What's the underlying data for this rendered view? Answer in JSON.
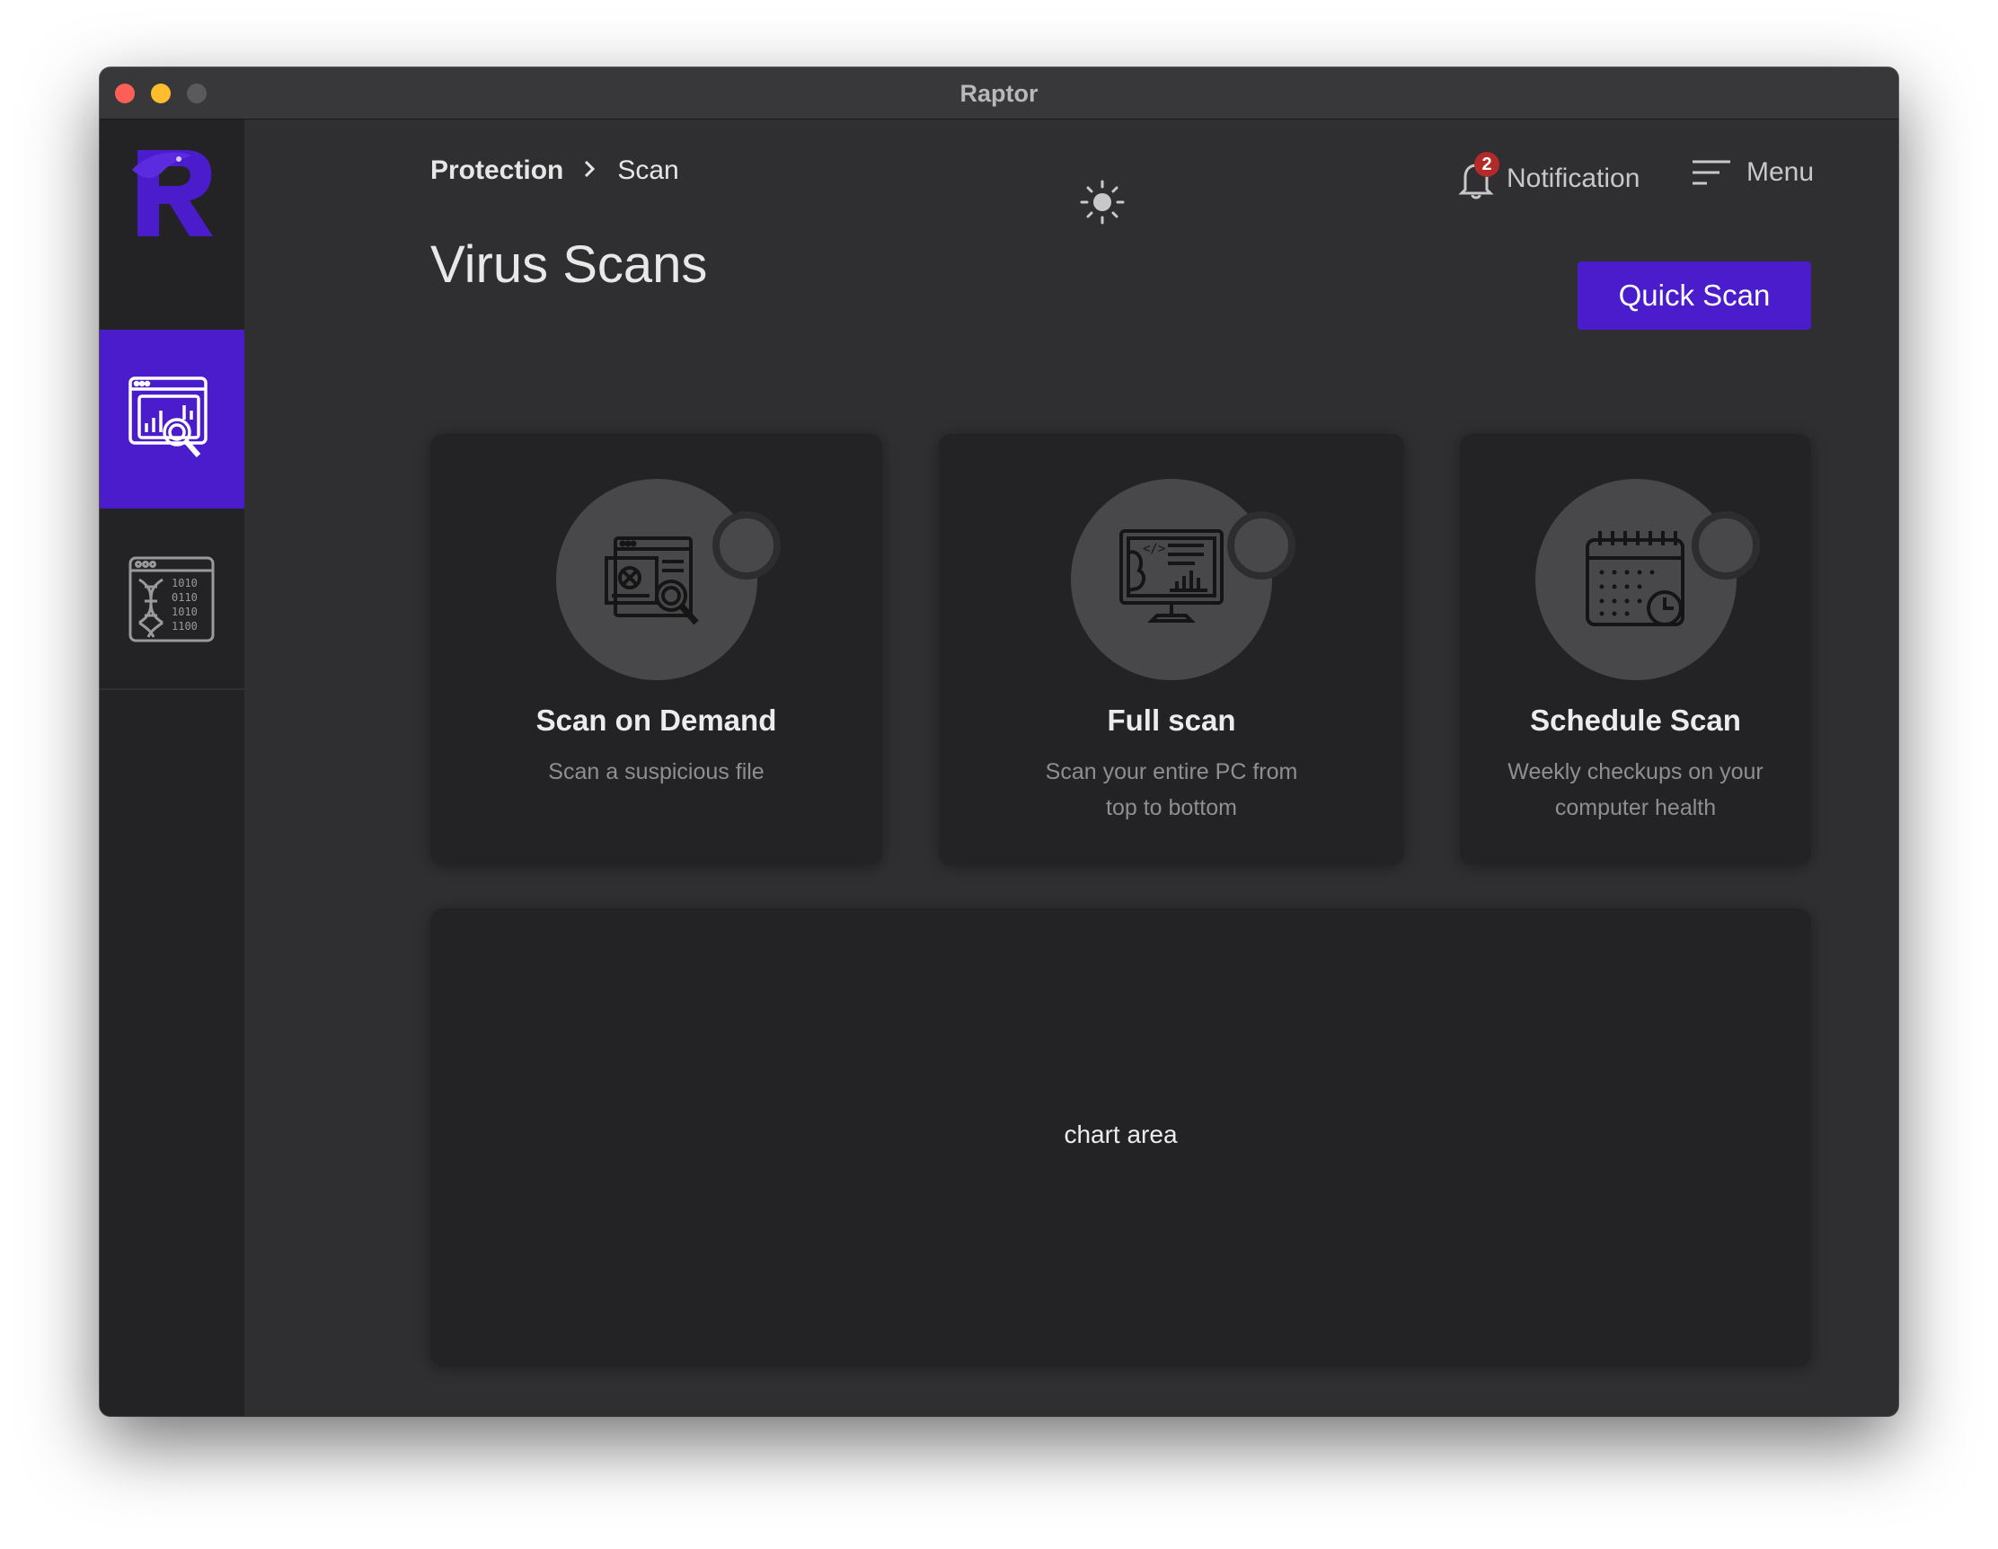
{
  "window": {
    "title": "Raptor"
  },
  "sidebar": {
    "items": [
      {
        "icon": "scan-analytics-icon",
        "active": true
      },
      {
        "icon": "dna-binary-icon",
        "active": false
      }
    ]
  },
  "breadcrumb": {
    "parent": "Protection",
    "current": "Scan"
  },
  "header": {
    "theme_icon": "sun-icon",
    "notification_label": "Notification",
    "notification_count": "2",
    "menu_label": "Menu"
  },
  "page": {
    "title": "Virus Scans",
    "quick_scan_label": "Quick Scan"
  },
  "cards": [
    {
      "icon": "scan-file-icon",
      "title": "Scan on Demand",
      "description": "Scan a suspicious file"
    },
    {
      "icon": "monitor-scan-icon",
      "title": "Full scan",
      "description": "Scan your entire PC from top to bottom"
    },
    {
      "icon": "calendar-clock-icon",
      "title": "Schedule Scan",
      "description": "Weekly checkups on your computer health"
    }
  ],
  "chart": {
    "placeholder": "chart area"
  },
  "colors": {
    "accent": "#4a1ccc",
    "badge": "#b32a2a",
    "background": "#2f2f31",
    "card": "#232325"
  }
}
